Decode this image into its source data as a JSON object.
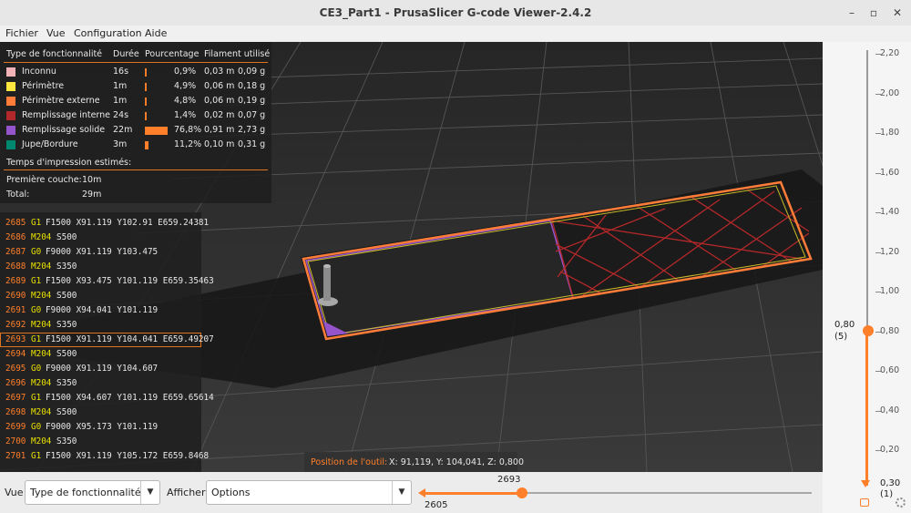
{
  "window": {
    "title": "CE3_Part1 - PrusaSlicer G-code Viewer-2.4.2",
    "minimize": "–",
    "maximize": "▫",
    "close": "✕"
  },
  "menu": [
    "Fichier",
    "Vue",
    "Configuration",
    "Aide"
  ],
  "legend": {
    "headers": [
      "Type de fonctionnalité",
      "Durée",
      "Pourcentage",
      "Filament utilisé"
    ],
    "rows": [
      {
        "label": "Inconnu",
        "color": "#f2b3b8",
        "time": "16s",
        "pct": "0,9%",
        "pct_value": 0.9,
        "meters": "0,03 m",
        "grams": "0,09 g"
      },
      {
        "label": "Périmètre",
        "color": "#ffe63f",
        "time": "1m",
        "pct": "4,9%",
        "pct_value": 4.9,
        "meters": "0,06 m",
        "grams": "0,18 g"
      },
      {
        "label": "Périmètre externe",
        "color": "#ff7d38",
        "time": "1m",
        "pct": "4,8%",
        "pct_value": 4.8,
        "meters": "0,06 m",
        "grams": "0,19 g"
      },
      {
        "label": "Remplissage interne",
        "color": "#b3282a",
        "time": "24s",
        "pct": "1,4%",
        "pct_value": 1.4,
        "meters": "0,02 m",
        "grams": "0,07 g"
      },
      {
        "label": "Remplissage solide",
        "color": "#9654cc",
        "time": "22m",
        "pct": "76,8%",
        "pct_value": 76.8,
        "meters": "0,91 m",
        "grams": "2,73 g"
      },
      {
        "label": "Jupe/Bordure",
        "color": "#00876e",
        "time": "3m",
        "pct": "11,2%",
        "pct_value": 11.2,
        "meters": "0,10 m",
        "grams": "0,31 g"
      }
    ],
    "estimates_title": "Temps d'impression estimés:",
    "first_layer_label": "Première couche:",
    "first_layer_value": "10m",
    "total_label": "Total:",
    "total_value": "29m"
  },
  "gcode": [
    {
      "line": "2685",
      "cmd": "G1",
      "args": "F1500 X91.119 Y102.91 E659.24381"
    },
    {
      "line": "2686",
      "cmd": "M204",
      "args": "S500"
    },
    {
      "line": "2687",
      "cmd": "G0",
      "args": "F9000 X91.119 Y103.475"
    },
    {
      "line": "2688",
      "cmd": "M204",
      "args": "S350"
    },
    {
      "line": "2689",
      "cmd": "G1",
      "args": "F1500 X93.475 Y101.119 E659.35463"
    },
    {
      "line": "2690",
      "cmd": "M204",
      "args": "S500"
    },
    {
      "line": "2691",
      "cmd": "G0",
      "args": "F9000 X94.041 Y101.119"
    },
    {
      "line": "2692",
      "cmd": "M204",
      "args": "S350"
    },
    {
      "line": "2693",
      "cmd": "G1",
      "args": "F1500 X91.119 Y104.041 E659.49207",
      "selected": true
    },
    {
      "line": "2694",
      "cmd": "M204",
      "args": "S500"
    },
    {
      "line": "2695",
      "cmd": "G0",
      "args": "F9000 X91.119 Y104.607"
    },
    {
      "line": "2696",
      "cmd": "M204",
      "args": "S350"
    },
    {
      "line": "2697",
      "cmd": "G1",
      "args": "F1500 X94.607 Y101.119 E659.65614"
    },
    {
      "line": "2698",
      "cmd": "M204",
      "args": "S500"
    },
    {
      "line": "2699",
      "cmd": "G0",
      "args": "F9000 X95.173 Y101.119"
    },
    {
      "line": "2700",
      "cmd": "M204",
      "args": "S350"
    },
    {
      "line": "2701",
      "cmd": "G1",
      "args": "F1500 X91.119 Y105.172 E659.8468"
    }
  ],
  "tool_position": {
    "label": "Position de l'outil:",
    "value": "X: 91,119, Y: 104,041, Z: 0,800"
  },
  "vertical_slider": {
    "ticks": [
      "2,20",
      "2,00",
      "1,80",
      "1,60",
      "1,40",
      "1,20",
      "1,00",
      "0,80",
      "0,60",
      "0,40",
      "0,20"
    ],
    "upper_value": "0,80",
    "upper_layer": "(5)",
    "lower_value": "0,30",
    "lower_layer": "(1)"
  },
  "bottom": {
    "view_label": "Vue",
    "view_value": "Type de fonctionnalité",
    "show_label": "Afficher",
    "show_value": "Options",
    "hslider_upper": "2693",
    "hslider_lower": "2605"
  },
  "colors": {
    "accent": "#ff7f2a",
    "infill": "#b3282a",
    "solid_infill": "#9654cc",
    "perimeter": "#ffe63f",
    "external_perimeter": "#ff7d38"
  }
}
